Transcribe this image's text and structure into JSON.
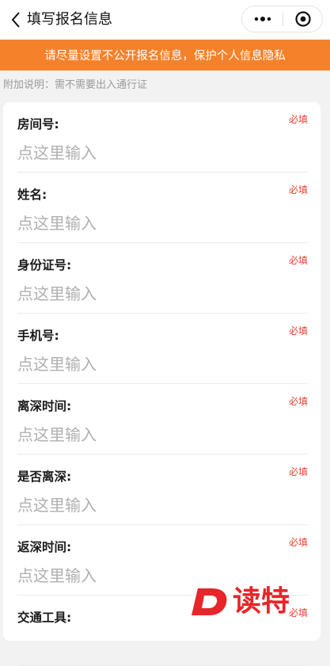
{
  "nav": {
    "title": "填写报名信息"
  },
  "banner": {
    "text": "请尽量设置不公开报名信息，保护个人信息隐私"
  },
  "note": {
    "text": "附加说明：需不需要出入通行证"
  },
  "fields": [
    {
      "label": "房间号:",
      "required": "必填",
      "placeholder": "点这里输入",
      "value": ""
    },
    {
      "label": "姓名:",
      "required": "必填",
      "placeholder": "点这里输入",
      "value": ""
    },
    {
      "label": "身份证号:",
      "required": "必填",
      "placeholder": "点这里输入",
      "value": ""
    },
    {
      "label": "手机号:",
      "required": "必填",
      "placeholder": "点这里输入",
      "value": ""
    },
    {
      "label": "离深时间:",
      "required": "必填",
      "placeholder": "点这里输入",
      "value": ""
    },
    {
      "label": "是否离深:",
      "required": "必填",
      "placeholder": "点这里输入",
      "value": ""
    },
    {
      "label": "返深时间:",
      "required": "必填",
      "placeholder": "点这里输入",
      "value": ""
    },
    {
      "label": "交通工具:",
      "required": "必填",
      "placeholder": "",
      "value": ""
    }
  ],
  "watermark": {
    "text": "读特"
  },
  "colors": {
    "accent": "#f5822b",
    "required": "#e8402f",
    "watermark": "#e8252a"
  },
  "icons": {
    "back": "chevron-left-icon",
    "more": "more-dots-icon",
    "close": "target-close-icon"
  }
}
